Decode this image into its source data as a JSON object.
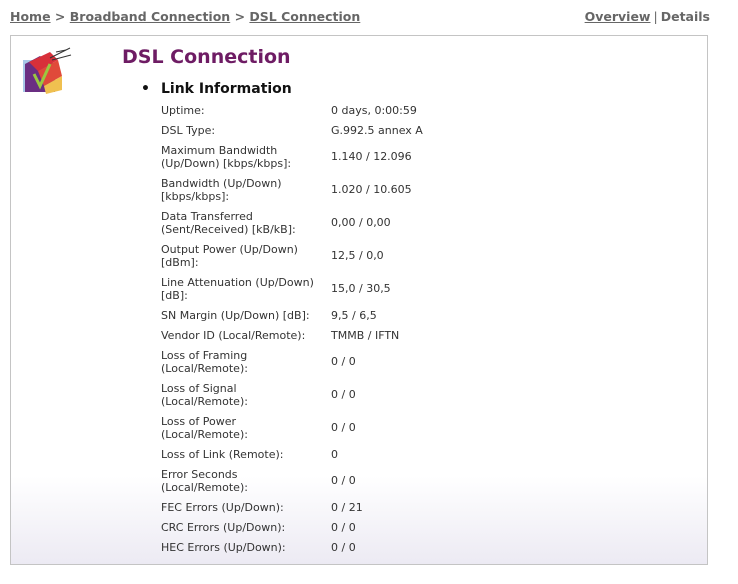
{
  "breadcrumb": [
    "Home",
    "Broadband Connection",
    "DSL Connection"
  ],
  "breadcrumb_separator": ">",
  "view_nav": {
    "overview": "Overview",
    "separator": "|",
    "details": "Details"
  },
  "page": {
    "title": "DSL Connection",
    "section": "Link Information"
  },
  "colors": {
    "title": "#6e1c64",
    "nav_text": "#666666",
    "panel_border": "#c4c4c4"
  },
  "icons": {
    "logo": "dsl-house-logo-icon",
    "bullet": "bullet-icon"
  },
  "rows": [
    {
      "label": "Uptime:",
      "value": "0 days, 0:00:59"
    },
    {
      "label": "DSL Type:",
      "value": "G.992.5 annex A"
    },
    {
      "label": "Maximum Bandwidth (Up/Down) [kbps/kbps]:",
      "value": "1.140 / 12.096"
    },
    {
      "label": "Bandwidth (Up/Down) [kbps/kbps]:",
      "value": "1.020 / 10.605"
    },
    {
      "label": "Data Transferred (Sent/Received) [kB/kB]:",
      "value": "0,00 / 0,00"
    },
    {
      "label": "Output Power (Up/Down) [dBm]:",
      "value": "12,5 / 0,0"
    },
    {
      "label": "Line Attenuation (Up/Down) [dB]:",
      "value": "15,0 / 30,5"
    },
    {
      "label": "SN Margin (Up/Down) [dB]:",
      "value": "9,5 / 6,5"
    },
    {
      "label": "Vendor ID (Local/Remote):",
      "value": "TMMB / IFTN"
    },
    {
      "label": "Loss of Framing (Local/Remote):",
      "value": "0 / 0"
    },
    {
      "label": "Loss of Signal (Local/Remote):",
      "value": "0 / 0"
    },
    {
      "label": "Loss of Power (Local/Remote):",
      "value": "0 / 0"
    },
    {
      "label": "Loss of Link (Remote):",
      "value": "0"
    },
    {
      "label": "Error Seconds (Local/Remote):",
      "value": "0 / 0"
    },
    {
      "label": "FEC Errors (Up/Down):",
      "value": "0 / 21"
    },
    {
      "label": "CRC Errors (Up/Down):",
      "value": "0 / 0"
    },
    {
      "label": "HEC Errors (Up/Down):",
      "value": "0 / 0"
    }
  ]
}
